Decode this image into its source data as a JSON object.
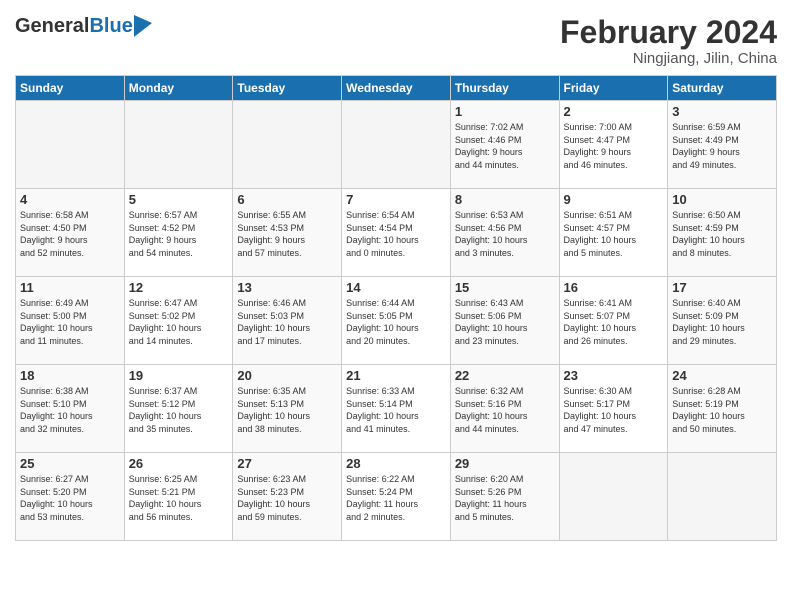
{
  "header": {
    "logo_general": "General",
    "logo_blue": "Blue",
    "month": "February 2024",
    "location": "Ningjiang, Jilin, China"
  },
  "days_of_week": [
    "Sunday",
    "Monday",
    "Tuesday",
    "Wednesday",
    "Thursday",
    "Friday",
    "Saturday"
  ],
  "weeks": [
    [
      {
        "day": "",
        "content": ""
      },
      {
        "day": "",
        "content": ""
      },
      {
        "day": "",
        "content": ""
      },
      {
        "day": "",
        "content": ""
      },
      {
        "day": "1",
        "content": "Sunrise: 7:02 AM\nSunset: 4:46 PM\nDaylight: 9 hours\nand 44 minutes."
      },
      {
        "day": "2",
        "content": "Sunrise: 7:00 AM\nSunset: 4:47 PM\nDaylight: 9 hours\nand 46 minutes."
      },
      {
        "day": "3",
        "content": "Sunrise: 6:59 AM\nSunset: 4:49 PM\nDaylight: 9 hours\nand 49 minutes."
      }
    ],
    [
      {
        "day": "4",
        "content": "Sunrise: 6:58 AM\nSunset: 4:50 PM\nDaylight: 9 hours\nand 52 minutes."
      },
      {
        "day": "5",
        "content": "Sunrise: 6:57 AM\nSunset: 4:52 PM\nDaylight: 9 hours\nand 54 minutes."
      },
      {
        "day": "6",
        "content": "Sunrise: 6:55 AM\nSunset: 4:53 PM\nDaylight: 9 hours\nand 57 minutes."
      },
      {
        "day": "7",
        "content": "Sunrise: 6:54 AM\nSunset: 4:54 PM\nDaylight: 10 hours\nand 0 minutes."
      },
      {
        "day": "8",
        "content": "Sunrise: 6:53 AM\nSunset: 4:56 PM\nDaylight: 10 hours\nand 3 minutes."
      },
      {
        "day": "9",
        "content": "Sunrise: 6:51 AM\nSunset: 4:57 PM\nDaylight: 10 hours\nand 5 minutes."
      },
      {
        "day": "10",
        "content": "Sunrise: 6:50 AM\nSunset: 4:59 PM\nDaylight: 10 hours\nand 8 minutes."
      }
    ],
    [
      {
        "day": "11",
        "content": "Sunrise: 6:49 AM\nSunset: 5:00 PM\nDaylight: 10 hours\nand 11 minutes."
      },
      {
        "day": "12",
        "content": "Sunrise: 6:47 AM\nSunset: 5:02 PM\nDaylight: 10 hours\nand 14 minutes."
      },
      {
        "day": "13",
        "content": "Sunrise: 6:46 AM\nSunset: 5:03 PM\nDaylight: 10 hours\nand 17 minutes."
      },
      {
        "day": "14",
        "content": "Sunrise: 6:44 AM\nSunset: 5:05 PM\nDaylight: 10 hours\nand 20 minutes."
      },
      {
        "day": "15",
        "content": "Sunrise: 6:43 AM\nSunset: 5:06 PM\nDaylight: 10 hours\nand 23 minutes."
      },
      {
        "day": "16",
        "content": "Sunrise: 6:41 AM\nSunset: 5:07 PM\nDaylight: 10 hours\nand 26 minutes."
      },
      {
        "day": "17",
        "content": "Sunrise: 6:40 AM\nSunset: 5:09 PM\nDaylight: 10 hours\nand 29 minutes."
      }
    ],
    [
      {
        "day": "18",
        "content": "Sunrise: 6:38 AM\nSunset: 5:10 PM\nDaylight: 10 hours\nand 32 minutes."
      },
      {
        "day": "19",
        "content": "Sunrise: 6:37 AM\nSunset: 5:12 PM\nDaylight: 10 hours\nand 35 minutes."
      },
      {
        "day": "20",
        "content": "Sunrise: 6:35 AM\nSunset: 5:13 PM\nDaylight: 10 hours\nand 38 minutes."
      },
      {
        "day": "21",
        "content": "Sunrise: 6:33 AM\nSunset: 5:14 PM\nDaylight: 10 hours\nand 41 minutes."
      },
      {
        "day": "22",
        "content": "Sunrise: 6:32 AM\nSunset: 5:16 PM\nDaylight: 10 hours\nand 44 minutes."
      },
      {
        "day": "23",
        "content": "Sunrise: 6:30 AM\nSunset: 5:17 PM\nDaylight: 10 hours\nand 47 minutes."
      },
      {
        "day": "24",
        "content": "Sunrise: 6:28 AM\nSunset: 5:19 PM\nDaylight: 10 hours\nand 50 minutes."
      }
    ],
    [
      {
        "day": "25",
        "content": "Sunrise: 6:27 AM\nSunset: 5:20 PM\nDaylight: 10 hours\nand 53 minutes."
      },
      {
        "day": "26",
        "content": "Sunrise: 6:25 AM\nSunset: 5:21 PM\nDaylight: 10 hours\nand 56 minutes."
      },
      {
        "day": "27",
        "content": "Sunrise: 6:23 AM\nSunset: 5:23 PM\nDaylight: 10 hours\nand 59 minutes."
      },
      {
        "day": "28",
        "content": "Sunrise: 6:22 AM\nSunset: 5:24 PM\nDaylight: 11 hours\nand 2 minutes."
      },
      {
        "day": "29",
        "content": "Sunrise: 6:20 AM\nSunset: 5:26 PM\nDaylight: 11 hours\nand 5 minutes."
      },
      {
        "day": "",
        "content": ""
      },
      {
        "day": "",
        "content": ""
      }
    ]
  ]
}
